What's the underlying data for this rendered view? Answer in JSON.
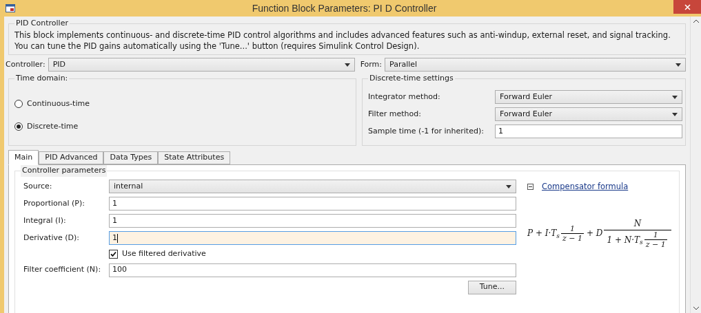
{
  "window": {
    "title": "Function Block Parameters: PI D Controller"
  },
  "description": {
    "title": "PID Controller",
    "text": "This block implements continuous- and discrete-time PID control algorithms and includes advanced features such as anti-windup, external reset, and signal tracking. You can tune the PID gains automatically using the 'Tune...' button (requires Simulink Control Design)."
  },
  "controller": {
    "label": "Controller:",
    "value": "PID"
  },
  "form": {
    "label": "Form:",
    "value": "Parallel"
  },
  "time_domain": {
    "title": "Time domain:",
    "options": [
      {
        "label": "Continuous-time",
        "selected": false
      },
      {
        "label": "Discrete-time",
        "selected": true
      }
    ]
  },
  "discrete_settings": {
    "title": "Discrete-time settings",
    "rows": [
      {
        "kind": "dropdown",
        "label": "Integrator method:",
        "value": "Forward Euler"
      },
      {
        "kind": "dropdown",
        "label": "Filter method:",
        "value": "Forward Euler"
      },
      {
        "kind": "text",
        "label": "Sample time (-1 for inherited):",
        "value": "1"
      }
    ]
  },
  "tabs": [
    {
      "label": "Main",
      "selected": true
    },
    {
      "label": "PID Advanced",
      "selected": false
    },
    {
      "label": "Data Types",
      "selected": false
    },
    {
      "label": "State Attributes",
      "selected": false
    }
  ],
  "parameters": {
    "title": "Controller parameters",
    "rows": [
      {
        "kind": "dropdown",
        "label": "Source:",
        "value": "internal"
      },
      {
        "kind": "text",
        "label": "Proportional (P):",
        "value": "1"
      },
      {
        "kind": "text",
        "label": "Integral (I):",
        "value": "1"
      },
      {
        "kind": "text",
        "label": "Derivative (D):",
        "value": "1",
        "focused": true
      },
      {
        "kind": "checkbox",
        "label": "Use filtered derivative",
        "checked": true
      },
      {
        "kind": "text",
        "label": "Filter coefficient (N):",
        "value": "100"
      }
    ],
    "tune_button": "Tune..."
  },
  "compensator": {
    "link": "Compensator formula",
    "expanded": true,
    "formula": {
      "lead": "P + I·T$_{s}$",
      "frac1_num": "1",
      "frac1_den": "z − 1",
      "mid": "+ D",
      "frac2_num": "N",
      "frac2_den_lead": "1 + N·T$_{s}$",
      "frac3_num": "1",
      "frac3_den": "z − 1"
    }
  }
}
